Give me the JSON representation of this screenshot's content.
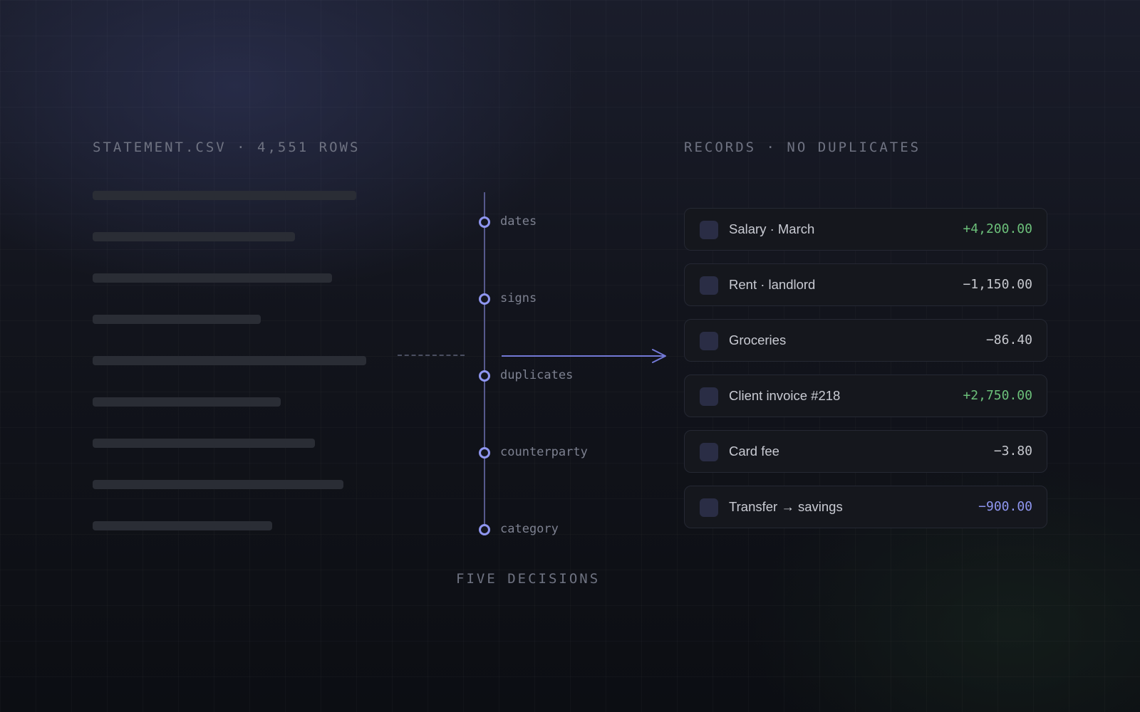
{
  "source": {
    "caption": "STATEMENT.CSV · 4,551 ROWS",
    "row_count": 9
  },
  "decisions": {
    "caption": "FIVE DECISIONS",
    "steps": [
      "dates",
      "signs",
      "duplicates",
      "counterparty",
      "category"
    ]
  },
  "records": {
    "caption": "RECORDS · NO DUPLICATES",
    "items": [
      {
        "title": "Salary · March",
        "amount": "+4,200.00",
        "kind": "positive"
      },
      {
        "title": "Rent · landlord",
        "amount": "−1,150.00",
        "kind": "negative"
      },
      {
        "title": "Groceries",
        "amount": "−86.40",
        "kind": "negative"
      },
      {
        "title": "Client invoice #218",
        "amount": "+2,750.00",
        "kind": "positive"
      },
      {
        "title": "Card fee",
        "amount": "−3.80",
        "kind": "negative"
      },
      {
        "title": "Transfer → savings",
        "amount": "−900.00",
        "kind": "transfer"
      }
    ]
  },
  "colors": {
    "accent": "#8f96f0",
    "positive": "#6cc07a",
    "neutral_amount": "#c6c8ce",
    "caption": "#6f7382"
  }
}
